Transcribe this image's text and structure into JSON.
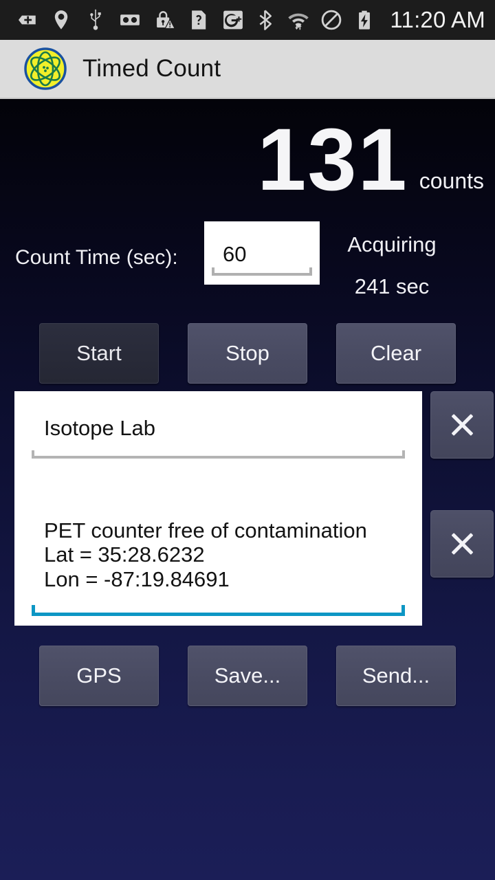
{
  "statusbar": {
    "time": "11:20 AM",
    "left_icons": [
      {
        "name": "add-shield-icon",
        "label": "add"
      },
      {
        "name": "location-pin-icon",
        "label": "location"
      },
      {
        "name": "usb-icon",
        "label": "usb"
      },
      {
        "name": "voicemail-icon",
        "label": "voicemail"
      },
      {
        "name": "lock-warning-icon",
        "label": "lock alert"
      },
      {
        "name": "question-document-icon",
        "label": "unknown document"
      },
      {
        "name": "google-plus-icon",
        "label": "google plus"
      }
    ],
    "right_icons": [
      {
        "name": "bluetooth-icon",
        "label": "bluetooth"
      },
      {
        "name": "wifi-transfer-icon",
        "label": "wifi"
      },
      {
        "name": "do-not-disturb-icon",
        "label": "do not disturb"
      },
      {
        "name": "battery-charging-icon",
        "label": "battery charging"
      }
    ]
  },
  "titlebar": {
    "app_icon": "atom-icon",
    "title": "Timed Count"
  },
  "readout": {
    "count_value": "131",
    "count_unit": "counts",
    "status": "Acquiring",
    "elapsed": "241 sec"
  },
  "count_time": {
    "label": "Count Time (sec):",
    "value": "60"
  },
  "controls": {
    "start": "Start",
    "stop": "Stop",
    "clear": "Clear",
    "gps": "GPS",
    "save": "Save...",
    "send": "Send..."
  },
  "fields": {
    "location_name": {
      "value": "Isotope Lab",
      "clear_icon": "close-icon"
    },
    "notes": {
      "value": "PET counter free of contamination\nLat = 35:28.6232\nLon = -87:19.84691",
      "clear_icon": "close-icon"
    }
  },
  "colors": {
    "statusbar_bg": "#1c1c1c",
    "titlebar_bg": "#dcdcdc",
    "background_top": "#030309",
    "background_bottom": "#1b1e57",
    "button_face": "#494b62",
    "button_disabled": "#282a38",
    "focus_underline": "#0d96c4",
    "icon_yellow": "#f2ef2a",
    "icon_blue": "#1a52a0"
  }
}
